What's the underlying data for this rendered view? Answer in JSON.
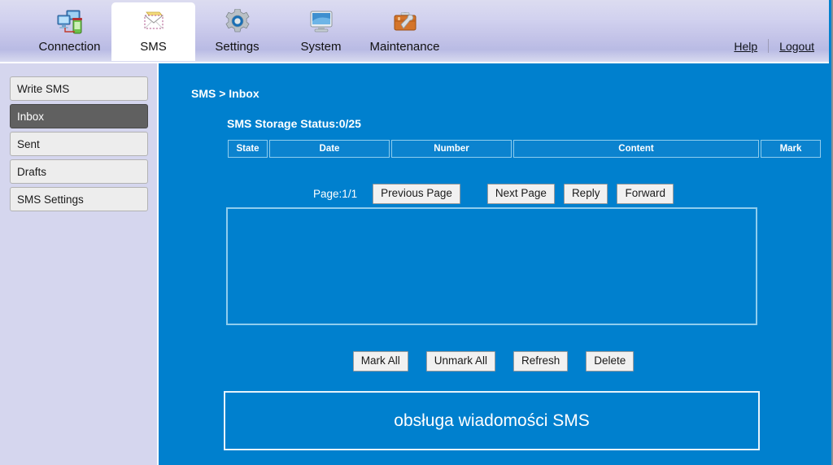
{
  "header": {
    "tabs": [
      {
        "id": "connection",
        "label": "Connection",
        "icon": "network-computers-icon",
        "active": false
      },
      {
        "id": "sms",
        "label": "SMS",
        "icon": "envelope-icon",
        "active": true
      },
      {
        "id": "settings",
        "label": "Settings",
        "icon": "gear-icon",
        "active": false
      },
      {
        "id": "system",
        "label": "System",
        "icon": "monitor-icon",
        "active": false
      },
      {
        "id": "maintenance",
        "label": "Maintenance",
        "icon": "toolbox-wrench-icon",
        "active": false
      }
    ],
    "help_label": "Help",
    "logout_label": "Logout"
  },
  "sidebar": {
    "items": [
      {
        "label": "Write SMS",
        "selected": false
      },
      {
        "label": "Inbox",
        "selected": true
      },
      {
        "label": "Sent",
        "selected": false
      },
      {
        "label": "Drafts",
        "selected": false
      },
      {
        "label": "SMS Settings",
        "selected": false
      }
    ]
  },
  "main": {
    "breadcrumb": "SMS > Inbox",
    "storage_status": "SMS Storage Status:0/25",
    "table": {
      "columns": [
        "State",
        "Date",
        "Number",
        "Content",
        "Mark"
      ],
      "rows": []
    },
    "pager": {
      "page_indicator": "Page:1/1",
      "previous_label": "Previous Page",
      "next_label": "Next Page",
      "reply_label": "Reply",
      "forward_label": "Forward"
    },
    "actions": {
      "mark_all_label": "Mark All",
      "unmark_all_label": "Unmark All",
      "refresh_label": "Refresh",
      "delete_label": "Delete"
    },
    "notice": "obsługa wiadomości SMS"
  },
  "colors": {
    "content_blue": "#0080ce",
    "sidebar_lavender": "#d5d6ee",
    "selected_item_gray": "#606060",
    "table_border_light_blue": "#8fcdee",
    "notice_border": "#e6f3fb"
  }
}
